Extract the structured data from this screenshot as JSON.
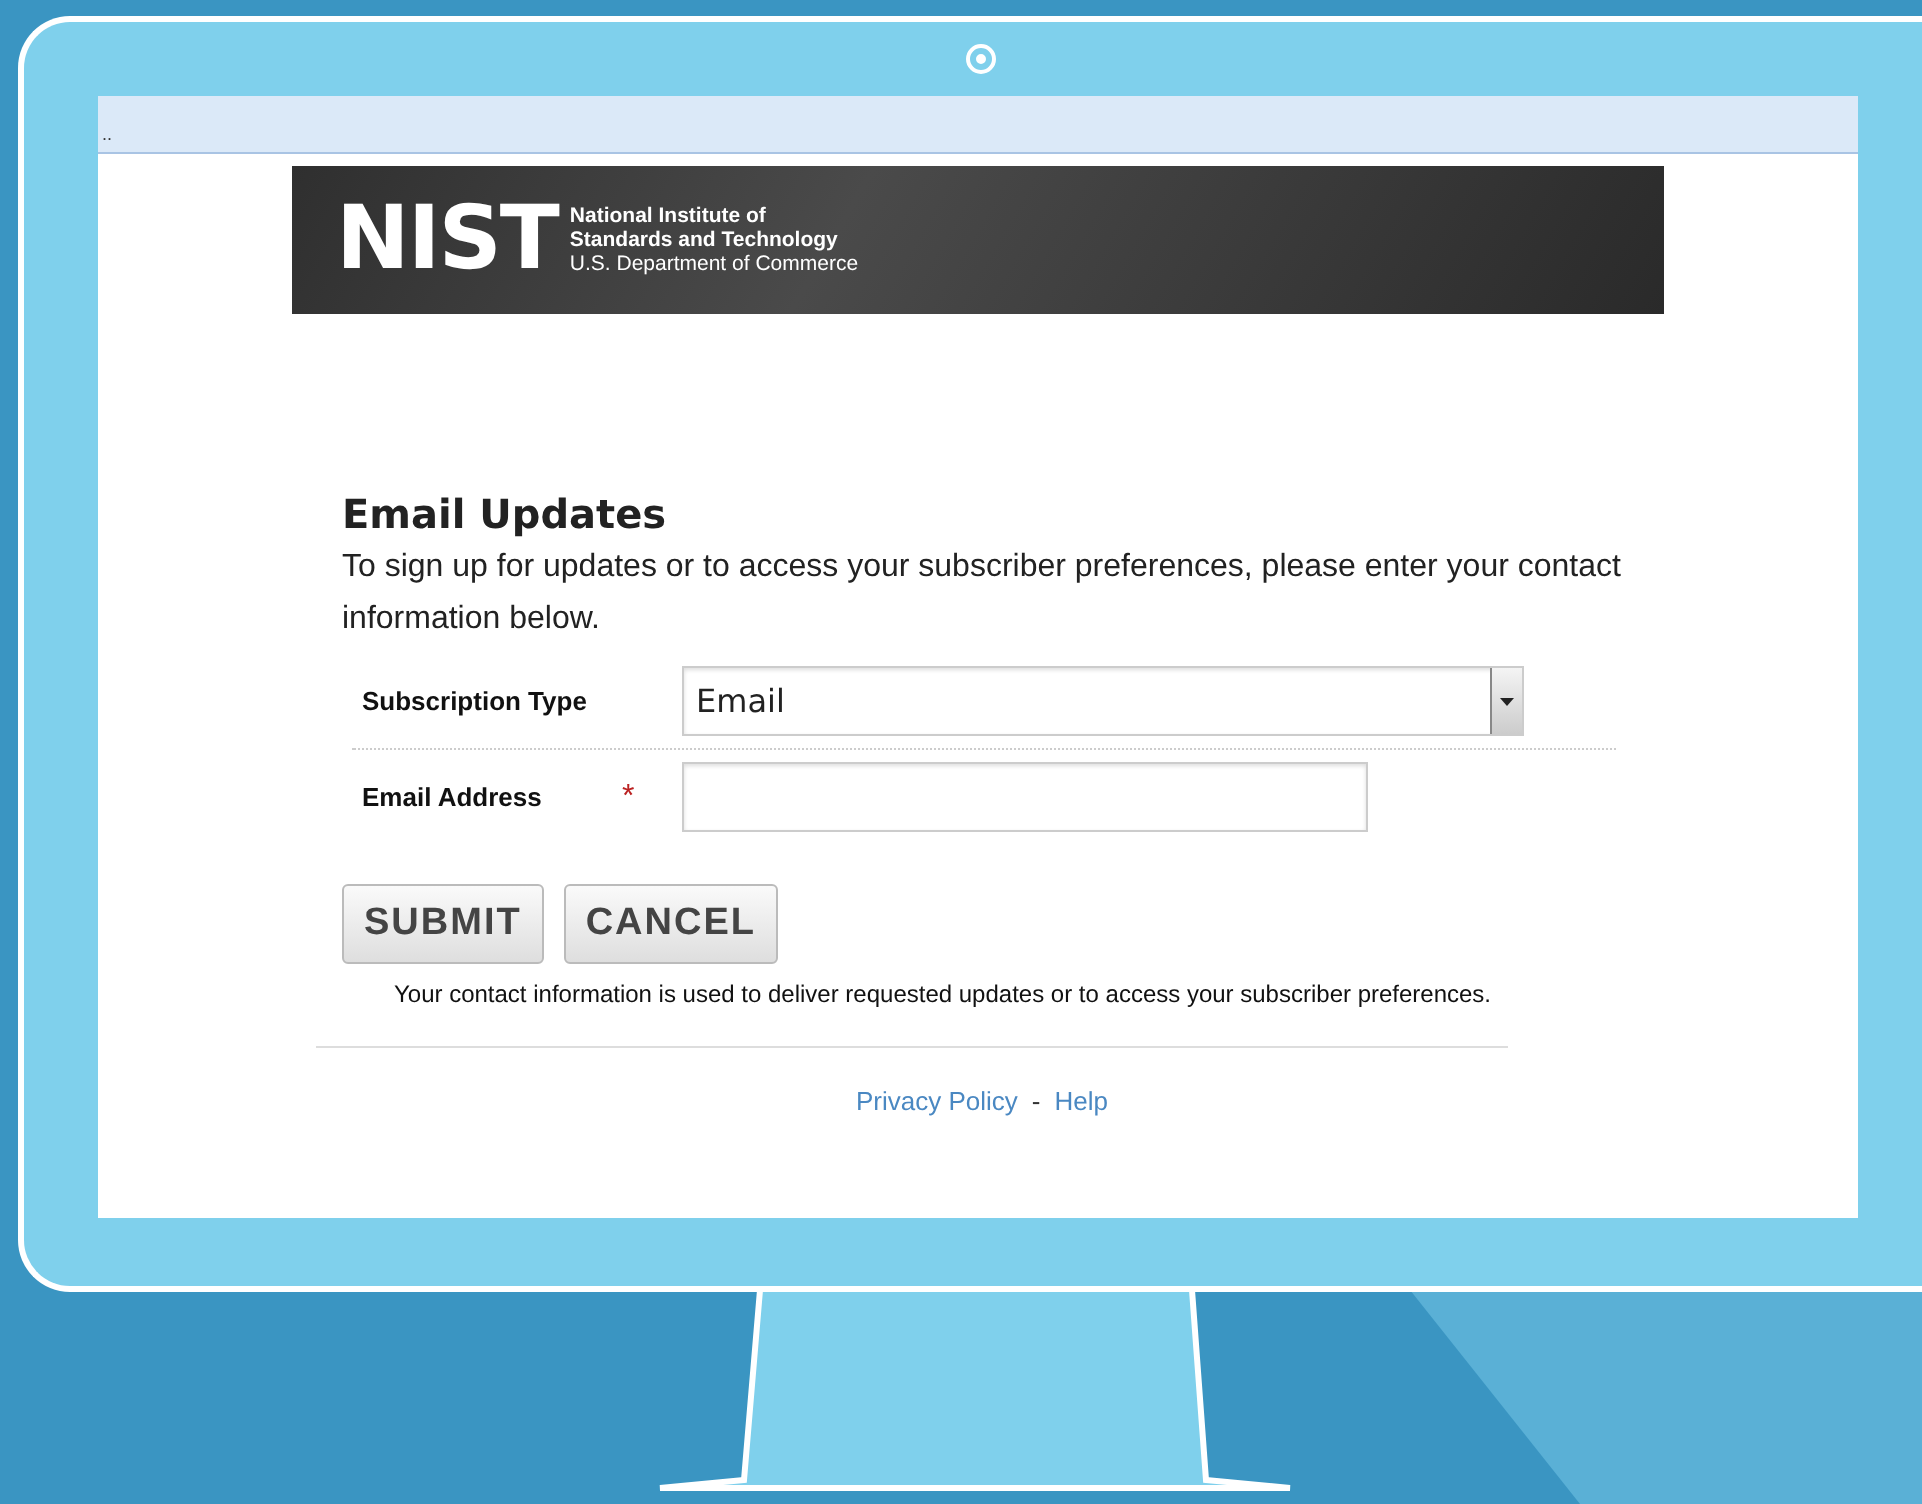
{
  "top_bar": {
    "text": ".."
  },
  "banner": {
    "logo": "NIST",
    "lines": [
      "National Institute of",
      "Standards and Technology",
      "U.S. Department of Commerce"
    ]
  },
  "heading": "Email Updates",
  "intro": "To sign up for updates or to access your subscriber preferences, please enter your contact information below.",
  "fields": [
    {
      "kind": "select",
      "label": "Subscription Type",
      "value": "Email"
    },
    {
      "kind": "text",
      "label": "Email Address",
      "required_mark": "*"
    }
  ],
  "buttons": [
    "SUBMIT",
    "CANCEL"
  ],
  "note": "Your contact information is used to deliver requested updates or to access your subscriber preferences.",
  "footer": {
    "links": [
      "Privacy Policy",
      "Help"
    ],
    "separator": "-"
  }
}
